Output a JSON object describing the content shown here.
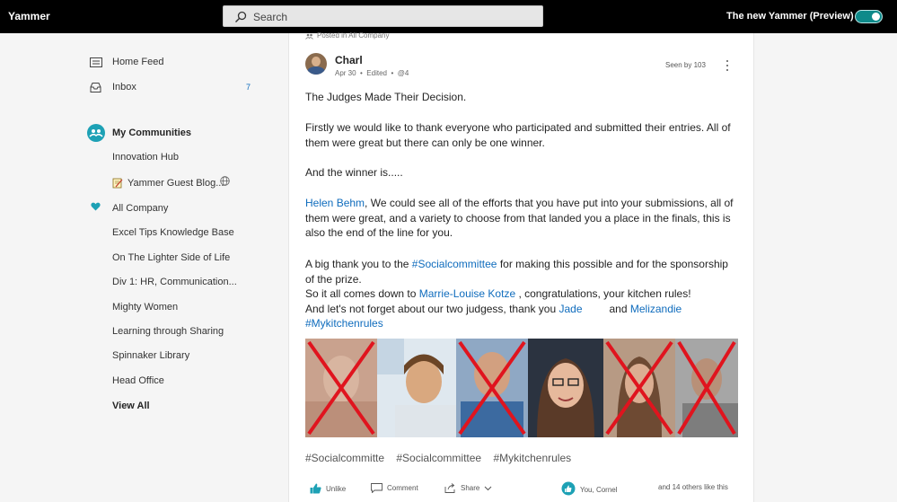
{
  "app": {
    "title": "Yammer"
  },
  "topbar": {
    "search_placeholder": "Search",
    "preview_label": "The new Yammer (Preview)",
    "accent": "#0e8a8a"
  },
  "sidebar": {
    "home_feed": "Home Feed",
    "inbox": "Inbox",
    "inbox_count": "7",
    "my_communities": "My Communities",
    "communities": [
      "Innovation Hub",
      "Yammer Guest Blog...",
      "All Company",
      "Excel Tips Knowledge Base",
      "On The Lighter Side of Life",
      "Div 1: HR, Communication...",
      "Mighty Women",
      "Learning through Sharing",
      "Spinnaker Library",
      "Head Office"
    ],
    "view_all": "View All"
  },
  "post": {
    "posted_in": "Posted in All Company",
    "author": "Charl",
    "date": "Apr 30",
    "edited": "Edited",
    "mention": "@4",
    "seen_by": "Seen by 103",
    "title": "The Judges Made Their Decision.",
    "para1": "Firstly we would like to thank everyone who participated and submitted their entries. All of them were great but there can only be one winner.",
    "para2": "And the winner is.....",
    "para3_link": "Helen Behm",
    "para3_text": ", We could see all of the efforts that you have put into your submissions, all of them were great, and a variety to choose from that landed you a place in the finals, this is also the end of the line for you.",
    "para4_a": "A big thank you to the ",
    "para4_tag": "#Socialcommittee",
    "para4_b": " for making this possible and for the sponsorship of the prize.",
    "para5_a": "So it all comes down to ",
    "para5_link": "Marrie-Louise Kotze",
    "para5_b": " , congratulations, your kitchen rules!",
    "para6_a": "And let's not forget about our two judgess, thank you ",
    "para6_link1": "Jade",
    "para6_mid": "and ",
    "para6_link2": "Melizandie",
    "para7_tag": "#Mykitchenrules",
    "tags": [
      "#Socialcommitte",
      "#Socialcommittee",
      "#Mykitchenrules"
    ],
    "actions": {
      "unlike": "Unlike",
      "comment": "Comment",
      "share": "Share",
      "liked_by": "You, Cornel",
      "others": "and 14 others like this"
    },
    "link_color": "#0f6cbd",
    "cross_color": "#e0141e"
  }
}
